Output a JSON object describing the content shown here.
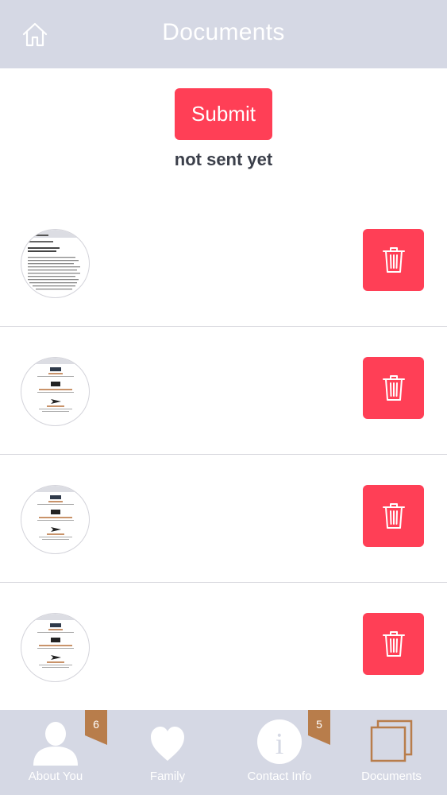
{
  "header": {
    "title": "Documents",
    "home_icon": "home-icon"
  },
  "submit": {
    "label": "Submit",
    "status": "not sent yet"
  },
  "documents": [
    {
      "thumbnail": "text-document-thumbnail",
      "delete_icon": "trash-icon"
    },
    {
      "thumbnail": "business-expense-form-thumbnail",
      "delete_icon": "trash-icon"
    },
    {
      "thumbnail": "business-expense-form-thumbnail",
      "delete_icon": "trash-icon"
    },
    {
      "thumbnail": "business-expense-form-thumbnail",
      "delete_icon": "trash-icon"
    }
  ],
  "tabs": [
    {
      "label": "About You",
      "icon": "person-icon",
      "badge": "6"
    },
    {
      "label": "Family",
      "icon": "heart-icon",
      "badge": ""
    },
    {
      "label": "Contact Info",
      "icon": "info-icon",
      "badge": "5"
    },
    {
      "label": "Documents",
      "icon": "documents-icon",
      "badge": "",
      "active": true
    }
  ],
  "colors": {
    "header_bg": "#d5d8e4",
    "accent_red": "#ff3f56",
    "badge_brown": "#b87d4b",
    "status_text": "#3b3f4a"
  }
}
